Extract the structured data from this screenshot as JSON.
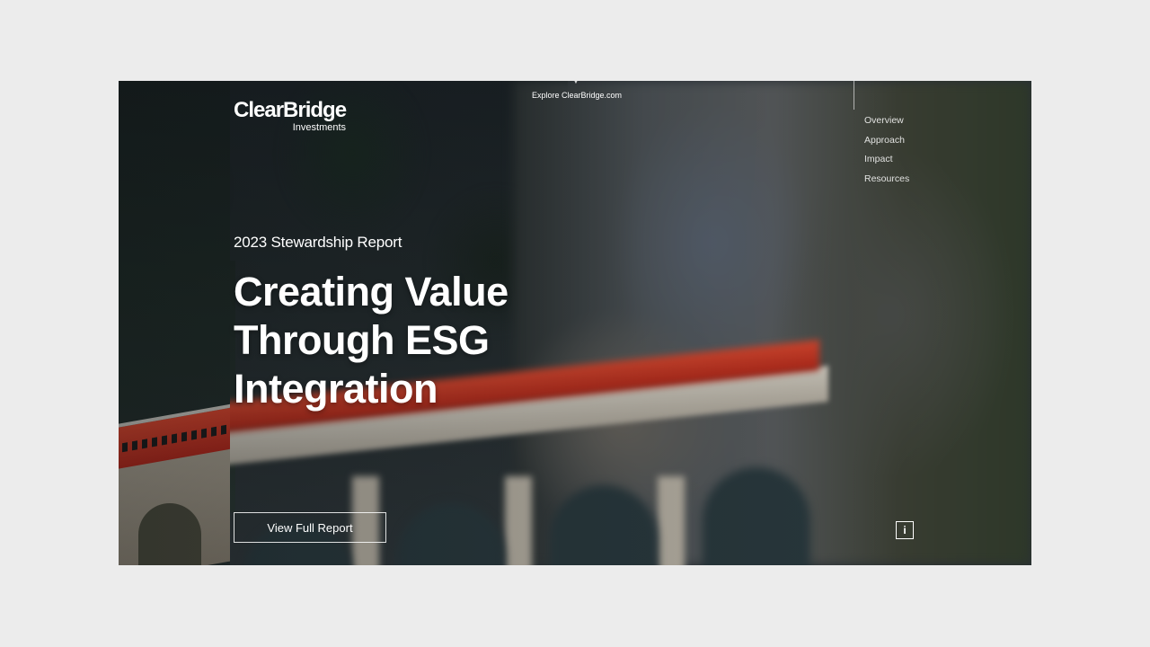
{
  "header": {
    "logo_main": "ClearBridge",
    "logo_sub": "Investments",
    "explore_label": "Explore ClearBridge.com"
  },
  "nav": {
    "items": [
      {
        "label": "Overview"
      },
      {
        "label": "Approach"
      },
      {
        "label": "Impact"
      },
      {
        "label": "Resources"
      }
    ]
  },
  "hero": {
    "subtitle": "2023 Stewardship Report",
    "title_lines": [
      "Creating Value",
      "Through ESG",
      "Integration"
    ],
    "cta_label": "View Full Report",
    "info_label": "i"
  },
  "colors": {
    "page_background": "#ececec",
    "text": "#ffffff",
    "train_red": "#d9442c"
  }
}
